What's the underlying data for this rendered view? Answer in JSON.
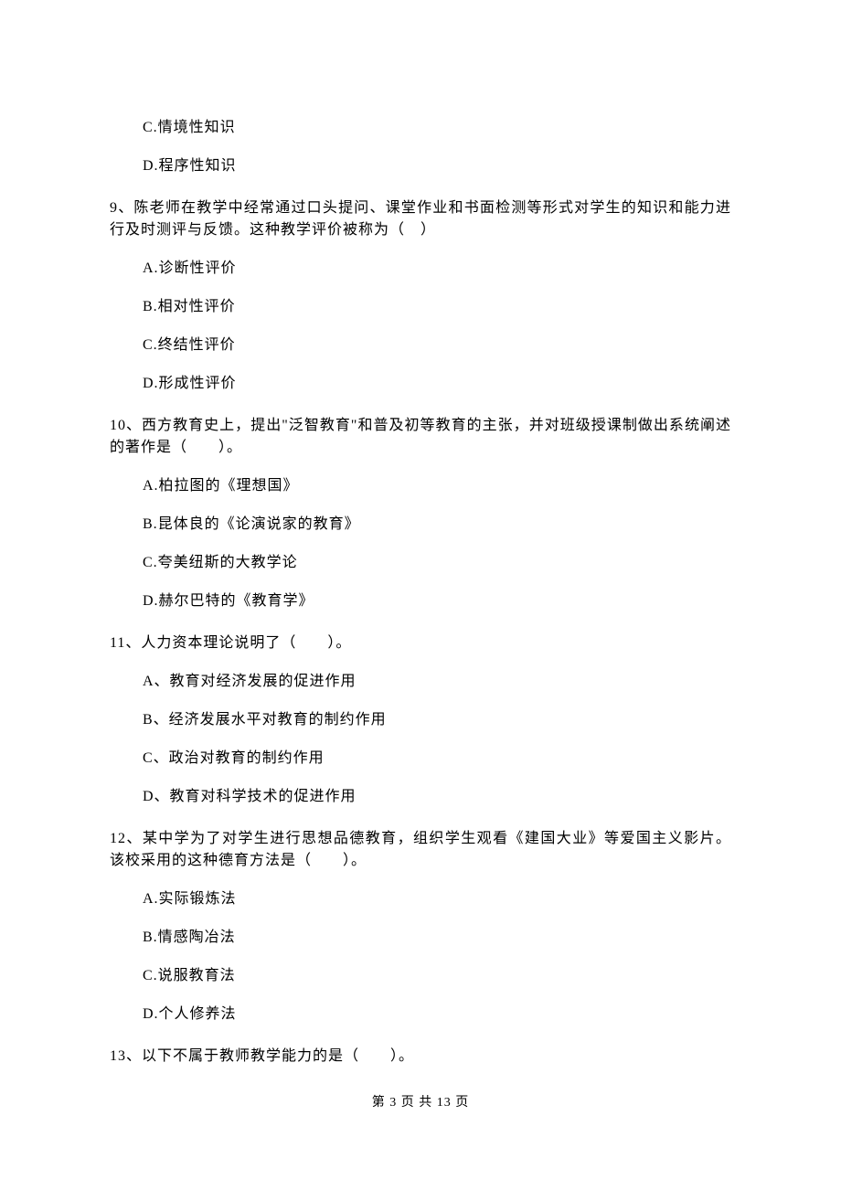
{
  "options_top": {
    "c": "C.情境性知识",
    "d": "D.程序性知识"
  },
  "q9": {
    "stem": "9、陈老师在教学中经常通过口头提问、课堂作业和书面检测等形式对学生的知识和能力进行及时测评与反馈。这种教学评价被称为（　）",
    "a": "A.诊断性评价",
    "b": "B.相对性评价",
    "c": "C.终结性评价",
    "d": "D.形成性评价"
  },
  "q10": {
    "stem": "10、西方教育史上，提出\"泛智教育\"和普及初等教育的主张，并对班级授课制做出系统阐述的著作是（　　）。",
    "a": "A.柏拉图的《理想国》",
    "b": "B.昆体良的《论演说家的教育》",
    "c": "C.夸美纽斯的大教学论",
    "d": "D.赫尔巴特的《教育学》"
  },
  "q11": {
    "stem": "11、人力资本理论说明了（　　）。",
    "a": "A、教育对经济发展的促进作用",
    "b": "B、经济发展水平对教育的制约作用",
    "c": "C、政治对教育的制约作用",
    "d": "D、教育对科学技术的促进作用"
  },
  "q12": {
    "stem": "12、某中学为了对学生进行思想品德教育，组织学生观看《建国大业》等爱国主义影片。该校采用的这种德育方法是（　　）。",
    "a": "A.实际锻炼法",
    "b": "B.情感陶冶法",
    "c": "C.说服教育法",
    "d": "D.个人修养法"
  },
  "q13": {
    "stem": "13、以下不属于教师教学能力的是（　　）。"
  },
  "footer": "第 3 页 共 13 页"
}
